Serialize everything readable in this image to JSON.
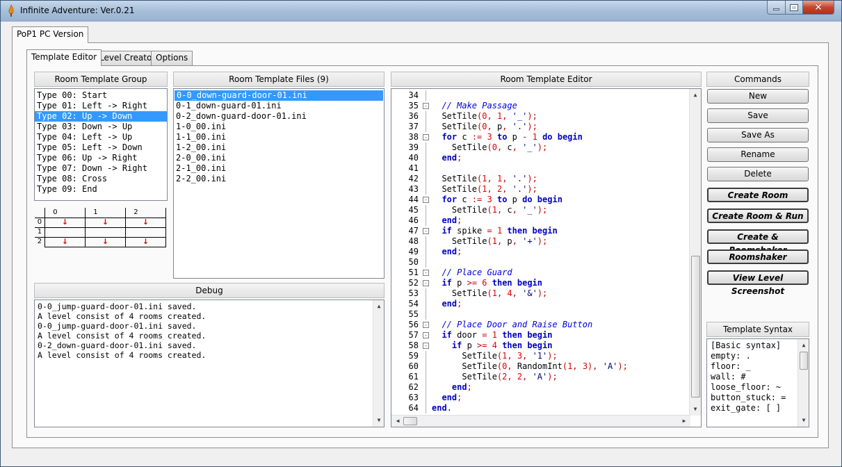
{
  "window": {
    "title": "Infinite Adventure: Ver.0.21"
  },
  "outer_tab": {
    "label": "PoP1 PC Version"
  },
  "inner_tabs": [
    {
      "label": "Template Editor",
      "active": true
    },
    {
      "label": "Level Creator",
      "active": false
    },
    {
      "label": "Options",
      "active": false
    }
  ],
  "room_template_group": {
    "header": "Room Template Group",
    "items": [
      "Type 00: Start",
      "Type 01: Left -> Right",
      "Type 02: Up -> Down",
      "Type 03: Down -> Up",
      "Type 04: Left -> Up",
      "Type 05: Left -> Down",
      "Type 06: Up -> Right",
      "Type 07: Down -> Right",
      "Type 08: Cross",
      "Type 09: End"
    ],
    "selected_index": 2
  },
  "room_grid": {
    "col_headers": [
      "0",
      "1",
      "2"
    ],
    "row_headers": [
      "0",
      "1",
      "2"
    ],
    "arrow_glyph": "↓"
  },
  "room_template_files": {
    "header": "Room Template Files (9)",
    "items": [
      "0-0_down-guard-door-01.ini",
      "0-1_down-guard-01.ini",
      "0-2_down-guard-door-01.ini",
      "1-0_00.ini",
      "1-1_00.ini",
      "1-2_00.ini",
      "2-0_00.ini",
      "2-1_00.ini",
      "2-2_00.ini"
    ],
    "selected_index": 0
  },
  "debug": {
    "header": "Debug",
    "lines": [
      "0-0_jump-guard-door-01.ini saved.",
      "A level consist of 4 rooms created.",
      "0-0_jump-guard-door-01.ini saved.",
      "A level consist of 4 rooms created.",
      "0-2_down-guard-door-01.ini saved.",
      "A level consist of 4 rooms created."
    ]
  },
  "editor": {
    "header": "Room Template Editor",
    "line_numbers": [
      "34",
      "35",
      "36",
      "37",
      "38",
      "39",
      "40",
      "41",
      "42",
      "43",
      "44",
      "45",
      "46",
      "47",
      "48",
      "49",
      "50",
      "51",
      "52",
      "53",
      "54",
      "55",
      "56",
      "57",
      "58",
      "59",
      "60",
      "61",
      "62",
      "63",
      "64"
    ]
  },
  "commands": {
    "header": "Commands",
    "buttons": [
      "New",
      "Save",
      "Save As",
      "Rename",
      "Delete",
      "Create Room",
      "Create Room & Run",
      "Create & Roomshaker",
      "Roomshaker",
      "View Level Screenshot"
    ]
  },
  "template_syntax": {
    "header": "Template Syntax",
    "lines": [
      "[Basic syntax]",
      "empty: .",
      "floor: _",
      "wall: #",
      "loose_floor: ~",
      "button_stuck: =",
      "exit_gate: [ ]"
    ]
  }
}
